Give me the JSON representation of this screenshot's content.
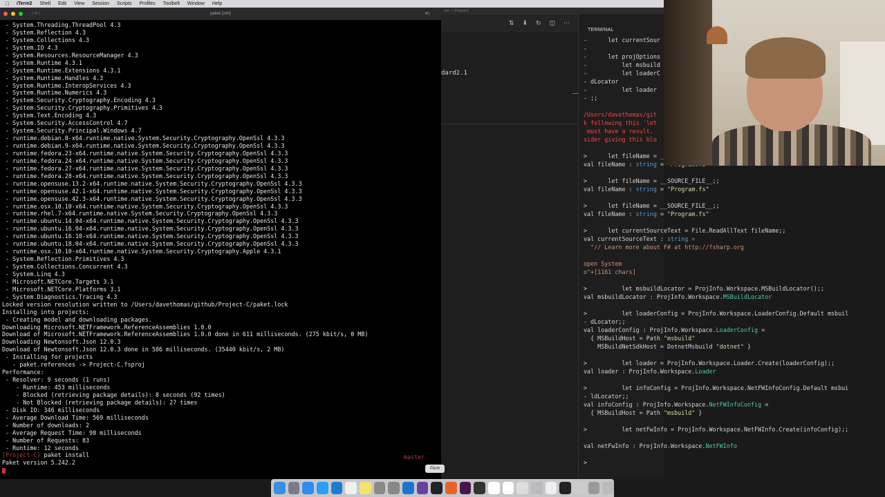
{
  "menubar": {
    "apple_icon": "apple-icon",
    "items": [
      "iTerm2",
      "Shell",
      "Edit",
      "View",
      "Session",
      "Scripts",
      "Profiles",
      "Toolbelt",
      "Window",
      "Help"
    ]
  },
  "iterm": {
    "tab_id": "⌥⌘1",
    "title": "paket (zsh)",
    "shortcut": "⌘1",
    "lines": [
      " - System.Threading.ThreadPool 4.3",
      " - System.Reflection 4.3",
      " - System.Collections 4.3",
      " - System.IO 4.3",
      " - System.Resources.ResourceManager 4.3",
      " - System.Runtime 4.3.1",
      " - System.Runtime.Extensions 4.3.1",
      " - System.Runtime.Handles 4.3",
      " - System.Runtime.InteropServices 4.3",
      " - System.Runtime.Numerics 4.3",
      " - System.Security.Cryptography.Encoding 4.3",
      " - System.Security.Cryptography.Primitives 4.3",
      " - System.Text.Encoding 4.3",
      " - System.Security.AccessControl 4.7",
      " - System.Security.Principal.Windows 4.7",
      " - runtime.debian.8-x64.runtime.native.System.Security.Cryptography.OpenSsl 4.3.3",
      " - runtime.debian.9-x64.runtime.native.System.Security.Cryptography.OpenSsl 4.3.3",
      " - runtime.fedora.23-x64.runtime.native.System.Security.Cryptography.OpenSsl 4.3.3",
      " - runtime.fedora.24-x64.runtime.native.System.Security.Cryptography.OpenSsl 4.3.3",
      " - runtime.fedora.27-x64.runtime.native.System.Security.Cryptography.OpenSsl 4.3.3",
      " - runtime.fedora.28-x64.runtime.native.System.Security.Cryptography.OpenSsl 4.3.3",
      " - runtime.opensuse.13.2-x64.runtime.native.System.Security.Cryptography.OpenSsl 4.3.3",
      " - runtime.opensuse.42.1-x64.runtime.native.System.Security.Cryptography.OpenSsl 4.3.3",
      " - runtime.opensuse.42.3-x64.runtime.native.System.Security.Cryptography.OpenSsl 4.3.3",
      " - runtime.osx.10.10-x64.runtime.native.System.Security.Cryptography.OpenSsl 4.3.3",
      " - runtime.rhel.7-x64.runtime.native.System.Security.Cryptography.OpenSsl 4.3.3",
      " - runtime.ubuntu.14.04-x64.runtime.native.System.Security.Cryptography.OpenSsl 4.3.3",
      " - runtime.ubuntu.16.04-x64.runtime.native.System.Security.Cryptography.OpenSsl 4.3.3",
      " - runtime.ubuntu.16.10-x64.runtime.native.System.Security.Cryptography.OpenSsl 4.3.3",
      " - runtime.ubuntu.18.04-x64.runtime.native.System.Security.Cryptography.OpenSsl 4.3.3",
      " - runtime.osx.10.10-x64.runtime.native.System.Security.Cryptography.Apple 4.3.1",
      " - System.Reflection.Primitives 4.3",
      " - System.Collections.Concurrent 4.3",
      " - System.Linq 4.3",
      " - Microsoft.NETCore.Targets 3.1",
      " - Microsoft.NETCore.Platforms 3.1",
      " - System.Diagnostics.Tracing 4.3",
      "Locked version resolution written to /Users/davethomas/github/Project-C/paket.lock",
      "Installing into projects:",
      " - Creating model and downloading packages.",
      "Downloading Microsoft.NETFramework.ReferenceAssemblies 1.0.0",
      "Download of Microsoft.NETFramework.ReferenceAssemblies 1.0.0 done in 611 milliseconds. (275 kbit/s, 0 MB)",
      "Downloading Newtonsoft.Json 12.0.3",
      "Download of Newtonsoft.Json 12.0.3 done in 586 milliseconds. (35440 kbit/s, 2 MB)",
      " - Installing for projects",
      "   - paket.references -> Project-C.fsproj",
      "Performance:",
      " - Resolver: 9 seconds (1 runs)",
      "    - Runtime: 453 milliseconds",
      "    - Blocked (retrieving package details): 8 seconds (92 times)",
      "    - Not Blocked (retrieving package details): 27 times",
      " - Disk IO: 346 milliseconds",
      " - Average Download Time: 569 milliseconds",
      " - Number of downloads: 2",
      " - Average Request Time: 98 milliseconds",
      " - Number of Requests: 83",
      " - Runtime: 12 seconds"
    ],
    "prompt": "[Project-C]",
    "command": " paket install",
    "branch": "master",
    "last_line": "Paket version 5.242.2"
  },
  "vscode": {
    "window_title": "ces — Project-C",
    "editor_text": "dard2.1",
    "panel_tab": "TERMINAL",
    "toolbar_icons": [
      "compare-icon",
      "download-icon",
      "sync-icon",
      "split-icon",
      "more-icon"
    ]
  },
  "fsi": [
    {
      "cls": "",
      "text": "-      let currentSour"
    },
    {
      "cls": "",
      "text": "-"
    },
    {
      "cls": "",
      "text": "-      let projOptions"
    },
    {
      "cls": "",
      "text": "-          let msbuild"
    },
    {
      "cls": "",
      "text": "-          let loaderC"
    },
    {
      "cls": "",
      "text": "- dLocator"
    },
    {
      "cls": "",
      "text": "-          let loader"
    },
    {
      "cls": "",
      "text": "- ;;"
    },
    {
      "cls": "",
      "text": ""
    },
    {
      "cls": "err",
      "text": "/Users/davethomas/git"
    },
    {
      "cls": "err",
      "text": "k following this 'let"
    },
    {
      "cls": "err",
      "text": " must have a result."
    },
    {
      "cls": "err",
      "text": "sider giving this blo"
    },
    {
      "cls": "",
      "text": ""
    },
    {
      "cls": "",
      "text": ">      let fileName = __SOURCE_FILE__;;"
    },
    {
      "cls": "mix1",
      "text": ""
    },
    {
      "cls": "",
      "text": ""
    },
    {
      "cls": "",
      "text": ">      let fileName = __SOURCE_FILE__;;"
    },
    {
      "cls": "mix1",
      "text": ""
    },
    {
      "cls": "",
      "text": ""
    },
    {
      "cls": "",
      "text": ">      let fileName = __SOURCE_FILE__;;"
    },
    {
      "cls": "mix1",
      "text": ""
    },
    {
      "cls": "",
      "text": ""
    },
    {
      "cls": "",
      "text": ">      let currentSourceText = File.ReadAllText fileName;;"
    },
    {
      "cls": "mix2",
      "text": ""
    },
    {
      "cls": "s",
      "text": "  \"// Learn more about F# at http://fsharp.org"
    },
    {
      "cls": "",
      "text": ""
    },
    {
      "cls": "s",
      "text": "open System"
    },
    {
      "cls": "s",
      "text": "o\"+[1161 chars]"
    },
    {
      "cls": "",
      "text": ""
    },
    {
      "cls": "",
      "text": ">          let msbuildLocator = ProjInfo.Workspace.MSBuildLocator();;"
    },
    {
      "cls": "mix3",
      "text": ""
    },
    {
      "cls": "",
      "text": ""
    },
    {
      "cls": "",
      "text": ">          let loaderConfig = ProjInfo.Workspace.LoaderConfig.Default msbuil"
    },
    {
      "cls": "",
      "text": "- dLocator;;"
    },
    {
      "cls": "mix4",
      "text": ""
    },
    {
      "cls": "mix5",
      "text": ""
    },
    {
      "cls": "mix6",
      "text": ""
    },
    {
      "cls": "",
      "text": ""
    },
    {
      "cls": "",
      "text": ">          let loader = ProjInfo.Workspace.Loader.Create(loaderConfig);;"
    },
    {
      "cls": "mix7",
      "text": ""
    },
    {
      "cls": "",
      "text": ""
    },
    {
      "cls": "",
      "text": ">          let infoConfig = ProjInfo.Workspace.NetFWInfoConfig.Default msbui"
    },
    {
      "cls": "",
      "text": "- ldLocator;;"
    },
    {
      "cls": "mix8",
      "text": ""
    },
    {
      "cls": "mix9",
      "text": ""
    },
    {
      "cls": "",
      "text": ""
    },
    {
      "cls": "",
      "text": ">          let netFwInfo = ProjInfo.Workspace.NetFWInfo.Create(infoConfig);;"
    },
    {
      "cls": "",
      "text": ""
    },
    {
      "cls": "mix10",
      "text": ""
    },
    {
      "cls": "",
      "text": ""
    },
    {
      "cls": "",
      "text": "> "
    }
  ],
  "fsi_parts": {
    "val_filename": "val fileName : ",
    "string_type": "string",
    "eq": " = ",
    "program_fs": "\"Program.fs\"",
    "val_cst": "val currentSourceText : ",
    "string_eq": "string =",
    "val_msbl": "val msbuildLocator : ProjInfo.Workspace.",
    "msbl_type": "MSBuildLocator",
    "val_lc": "val loaderConfig : ProjInfo.Workspace.",
    "lc_type": "LoaderConfig",
    "lc_eq": " =",
    "msb_host": "  { MSBuildHost = Path ",
    "msbuild_s": "\"msbuild\"",
    "msb_sdk": "    MSBuildNetSdkHost = DotnetMsbuild ",
    "dotnet_s": "\"dotnet\"",
    "close_b": " }",
    "val_loader": "val loader : ProjInfo.Workspace.",
    "loader_type": "Loader",
    "val_ic": "val infoConfig : ProjInfo.Workspace.",
    "ic_type": "NetFWInfoConfig",
    "val_nfi": "val netFwInfo : ProjInfo.Workspace.",
    "nfi_type": "NetFWInfo"
  },
  "dock": {
    "tooltip": "iTerm",
    "icons": [
      "finder-icon",
      "launchpad-icon",
      "app-store-icon",
      "safari-icon",
      "vscode-icon",
      "calendar-icon",
      "notes-icon",
      "settings-icon",
      "screenshot-icon",
      "xcode-icon",
      "github-desktop-icon",
      "iterm-icon",
      "firefox-icon",
      "slack-icon",
      "obs-icon",
      "document-icon",
      "document-icon",
      "preview-icon",
      "archive-icon",
      "blank-icon",
      "terminal-icon",
      "image-icon",
      "window-icon",
      "trash-icon"
    ]
  }
}
